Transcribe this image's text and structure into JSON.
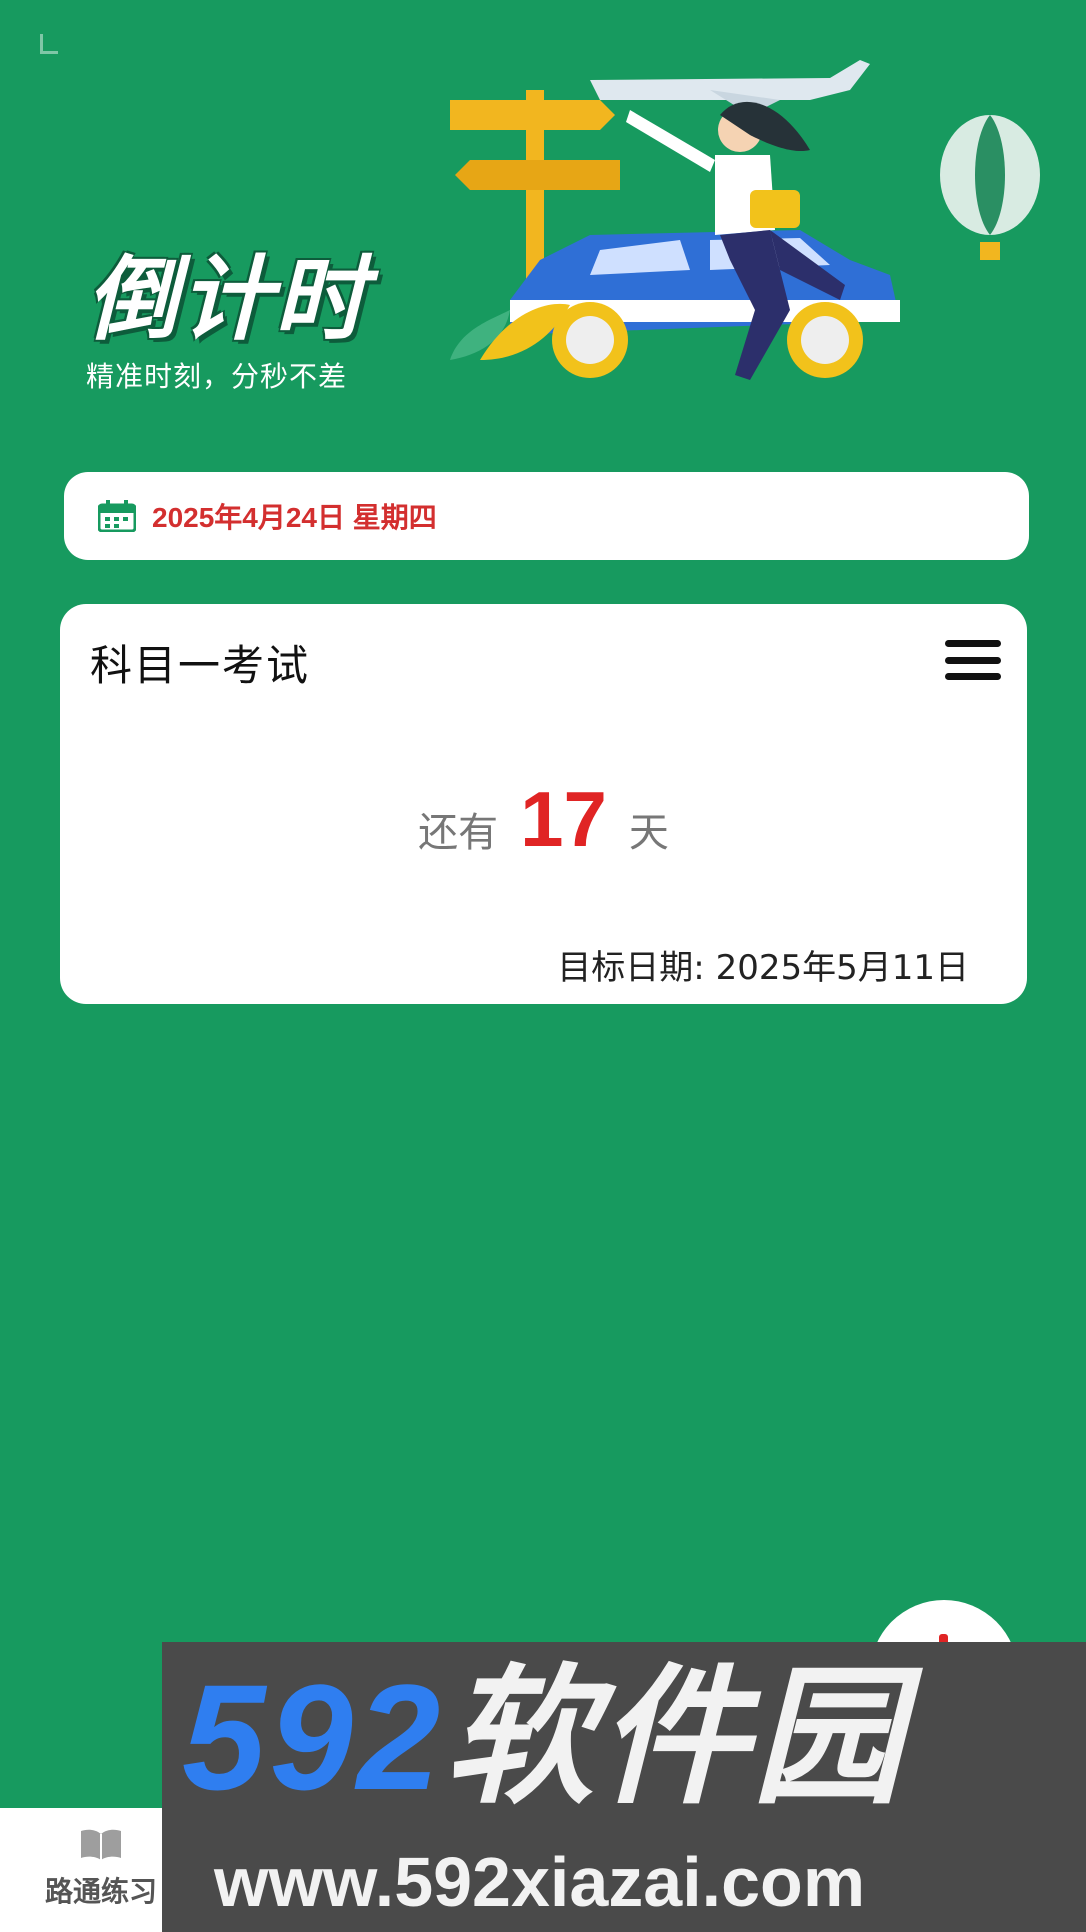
{
  "header": {
    "title": "倒计时",
    "subtitle": "精准时刻，分秒不差"
  },
  "today": {
    "date_text": "2025年4月24日 星期四",
    "icon": "calendar-icon"
  },
  "countdown": {
    "title": "科目一考试",
    "prefix": "还有",
    "days": "17",
    "suffix": "天",
    "target_label": "目标日期: 2025年5月11日",
    "menu_icon": "menu-icon"
  },
  "bottom_nav": {
    "items": [
      {
        "label": "路通练习",
        "icon": "book-icon"
      }
    ]
  },
  "watermark": {
    "brand_digits": "592",
    "brand_text": "软件园",
    "url": "www.592xiazai.com"
  },
  "colors": {
    "background": "#179a5f",
    "accent_red": "#e02424",
    "date_red": "#d32f2f",
    "card": "#ffffff"
  }
}
